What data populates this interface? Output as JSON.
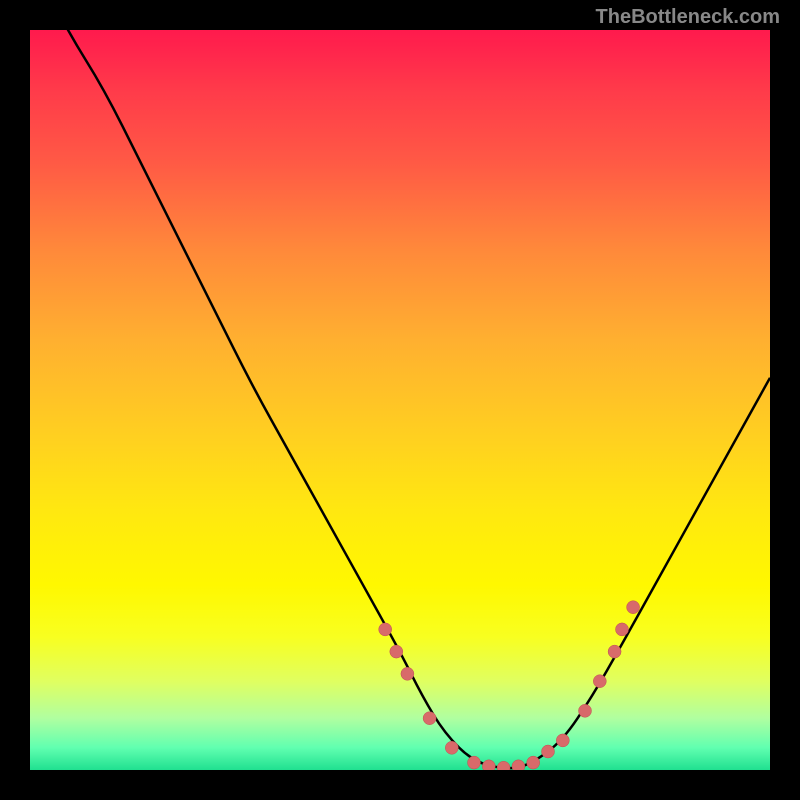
{
  "watermark": "TheBottleneck.com",
  "chart_data": {
    "type": "line",
    "title": "",
    "xlabel": "",
    "ylabel": "",
    "xlim": [
      0,
      100
    ],
    "ylim": [
      0,
      100
    ],
    "grid": false,
    "legend": false,
    "series": [
      {
        "name": "bottleneck-curve",
        "x": [
          0,
          5,
          10,
          15,
          20,
          25,
          30,
          35,
          40,
          45,
          50,
          53,
          56,
          60,
          65,
          68,
          72,
          76,
          80,
          85,
          90,
          95,
          100
        ],
        "y": [
          110,
          100,
          92,
          82,
          72,
          62,
          52,
          43,
          34,
          25,
          16,
          10,
          5,
          1,
          0,
          1,
          4,
          10,
          17,
          26,
          35,
          44,
          53
        ]
      }
    ],
    "scatter_points": {
      "name": "data-points",
      "x": [
        48,
        49.5,
        51,
        54,
        57,
        60,
        62,
        64,
        66,
        68,
        70,
        72,
        75,
        77,
        79,
        80,
        81.5
      ],
      "y": [
        19,
        16,
        13,
        7,
        3,
        1,
        0.5,
        0.3,
        0.5,
        1,
        2.5,
        4,
        8,
        12,
        16,
        19,
        22
      ]
    }
  }
}
